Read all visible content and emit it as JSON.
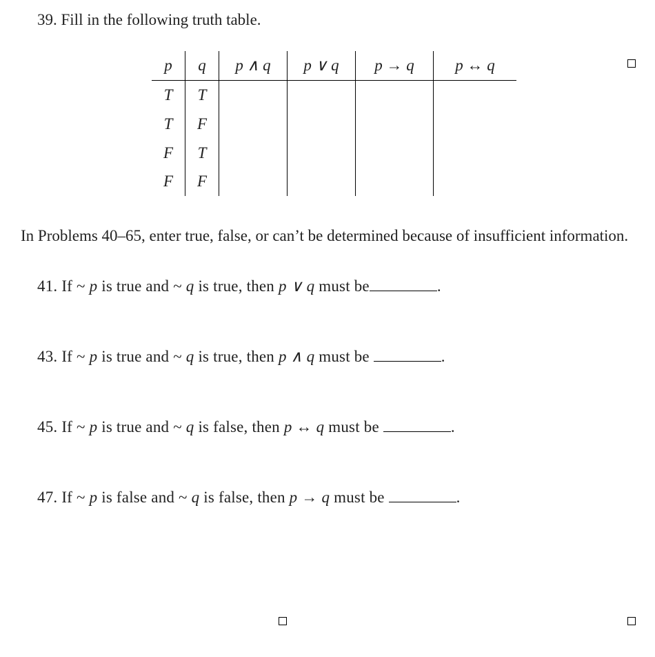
{
  "q39": {
    "number": "39.",
    "text": "Fill in the following truth table.",
    "headers": [
      "p",
      "q",
      "p ∧ q",
      "p ∨ q",
      "p → q",
      "p ↔ q"
    ],
    "rows": [
      [
        "T",
        "T",
        "",
        "",
        "",
        ""
      ],
      [
        "T",
        "F",
        "",
        "",
        "",
        ""
      ],
      [
        "F",
        "T",
        "",
        "",
        "",
        ""
      ],
      [
        "F",
        "F",
        "",
        "",
        "",
        ""
      ]
    ]
  },
  "instructions": "In Problems 40–65, enter true, false, or can’t be determined because of insufficient information.",
  "problems": [
    {
      "num": "41.",
      "pre": "If ~ ",
      "var1": "p",
      "mid1": " is true and ~ ",
      "var2": "q",
      "mid2": " is true, then ",
      "expr": "p ∨ q",
      "post": " must be",
      "tail": "."
    },
    {
      "num": "43.",
      "pre": "If ~ ",
      "var1": "p",
      "mid1": " is true and ~ ",
      "var2": "q",
      "mid2": " is true, then ",
      "expr": "p ∧ q",
      "post": " must be ",
      "tail": "."
    },
    {
      "num": "45.",
      "pre": "If ~ ",
      "var1": "p",
      "mid1": " is true and ~ ",
      "var2": "q",
      "mid2": " is false, then ",
      "expr": "p ↔ q",
      "post": " must be ",
      "tail": "."
    },
    {
      "num": "47.",
      "pre": "If ~ ",
      "var1": "p",
      "mid1": " is false and ~ ",
      "var2": "q",
      "mid2": " is false, then ",
      "expr": "p → q",
      "post": " must be ",
      "tail": "."
    }
  ]
}
